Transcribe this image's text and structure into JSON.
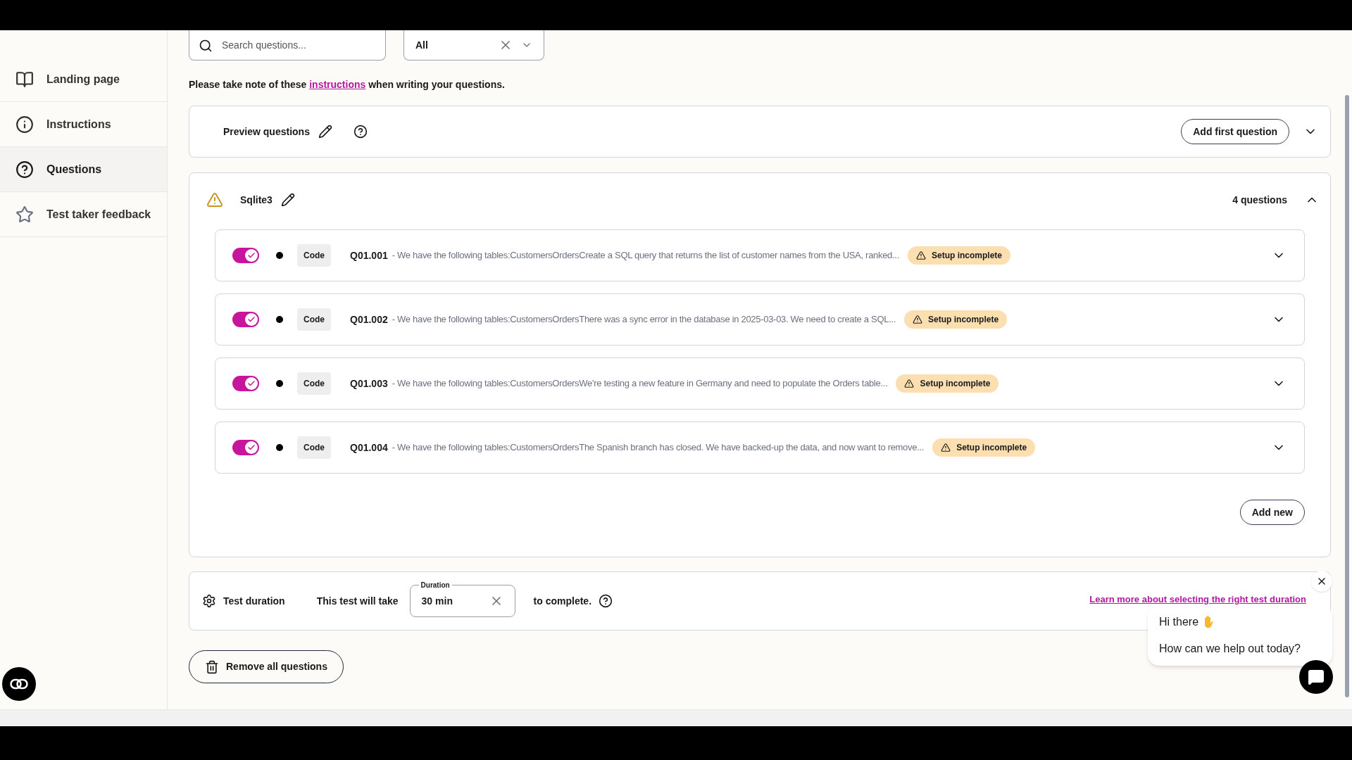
{
  "sidebar": {
    "items": [
      {
        "label": "Landing page",
        "selected": false
      },
      {
        "label": "Instructions",
        "selected": false
      },
      {
        "label": "Questions",
        "selected": true
      },
      {
        "label": "Test taker feedback",
        "selected": false
      }
    ]
  },
  "filters": {
    "search": {
      "placeholder": "Search questions..."
    },
    "type_select": {
      "value": "All"
    }
  },
  "note": {
    "before": "Please take note of these",
    "link": "instructions",
    "after": "when writing your questions."
  },
  "preview": {
    "title": "Preview questions",
    "button": "Add first question",
    "expanded": false
  },
  "section": {
    "title": "Sqlite3",
    "count": "4 questions",
    "expanded": true,
    "warning": true,
    "questions": [
      {
        "enabled": true,
        "type": "Code",
        "id": "Q01.001",
        "text": "- We have the following tables:CustomersOrdersCreate a SQL query that returns the list of customer names from the USA, ranked...",
        "status": "Setup incomplete"
      },
      {
        "enabled": true,
        "type": "Code",
        "id": "Q01.002",
        "text": "- We have the following tables:CustomersOrdersThere was a sync error in the database in 2025-03-03. We need to create a SQL...",
        "status": "Setup incomplete"
      },
      {
        "enabled": true,
        "type": "Code",
        "id": "Q01.003",
        "text": "- We have the following tables:CustomersOrdersWe're testing a new feature in Germany and need to populate the Orders table...",
        "status": "Setup incomplete"
      },
      {
        "enabled": true,
        "type": "Code",
        "id": "Q01.004",
        "text": "- We have the following tables:CustomersOrdersThe Spanish branch has closed. We have backed-up the data, and now want to remove...",
        "status": "Setup incomplete"
      }
    ],
    "add_button": "Add new"
  },
  "duration": {
    "title": "Test duration",
    "before": "This test will take",
    "field_label": "Duration",
    "value": "30 min",
    "after": "to complete.",
    "link": "Learn more about selecting the right test duration"
  },
  "remove_button": "Remove all questions",
  "chat": {
    "greeting": "Hi there",
    "message": "How can we help out today?"
  }
}
